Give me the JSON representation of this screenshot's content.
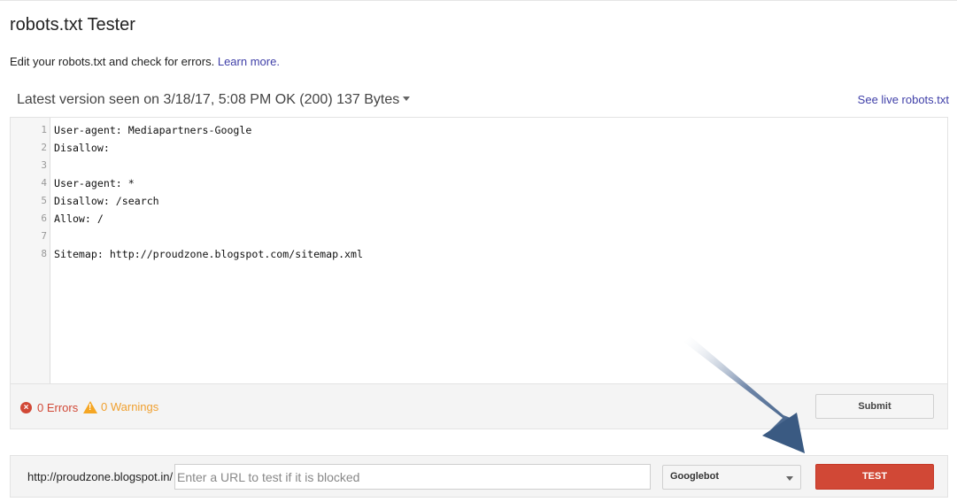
{
  "header": {
    "title": "robots.txt Tester",
    "subtitle": "Edit your robots.txt and check for errors.",
    "learn_more": "Learn more."
  },
  "version": {
    "label": "Latest version seen on 3/18/17, 5:08 PM OK (200) 137 Bytes",
    "see_live": "See live robots.txt"
  },
  "editor": {
    "lines": [
      {
        "no": "1",
        "text": "User-agent: Mediapartners-Google"
      },
      {
        "no": "2",
        "text": "Disallow:"
      },
      {
        "no": "3",
        "text": ""
      },
      {
        "no": "4",
        "text": "User-agent: *"
      },
      {
        "no": "5",
        "text": "Disallow: /search"
      },
      {
        "no": "6",
        "text": "Allow: /"
      },
      {
        "no": "7",
        "text": ""
      },
      {
        "no": "8",
        "text": "Sitemap: http://proudzone.blogspot.com/sitemap.xml"
      }
    ]
  },
  "status": {
    "errors": "0 Errors",
    "warnings": "0 Warnings",
    "submit": "Submit",
    "error_color": "#d14836",
    "warning_color": "#f0a030"
  },
  "test": {
    "url_prefix": "http://proudzone.blogspot.in/",
    "placeholder": "Enter a URL to test if it is blocked",
    "bot": "Googlebot",
    "button": "TEST",
    "button_color": "#d14836"
  },
  "icons": {
    "error": "error-circle-icon",
    "warning": "warning-triangle-icon",
    "dropdown": "caret-down-icon",
    "annotation": "pointer-arrow-icon"
  }
}
